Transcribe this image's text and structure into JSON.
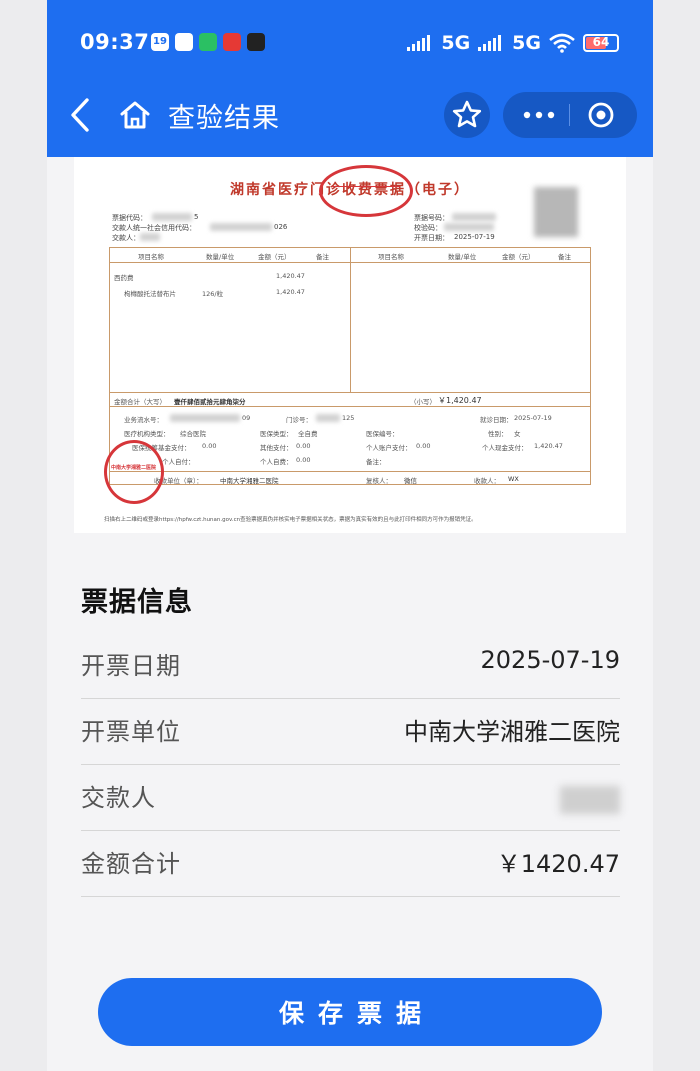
{
  "status_bar": {
    "time": "09:37",
    "network_1": "5G",
    "network_2": "5G",
    "battery": "64",
    "apps": [
      {
        "icon": "calendar-icon",
        "label": "19",
        "color": "#ffffff",
        "text_color": "#1e6ef0"
      },
      {
        "icon": "chat-bubble-icon",
        "label": "",
        "color": "#ffffff",
        "text_color": "#1e6ef0"
      },
      {
        "icon": "wechat-icon",
        "label": "",
        "color": "#2bc063",
        "text_color": "#ffffff"
      },
      {
        "icon": "red-app-icon",
        "label": "",
        "color": "#e53935",
        "text_color": "#ffffff"
      },
      {
        "icon": "black-app-icon",
        "label": "",
        "color": "#222222",
        "text_color": "#ffffff"
      }
    ]
  },
  "header": {
    "title": "查验结果",
    "back_icon": "chevron-left-icon",
    "home_icon": "home-icon",
    "favorite_icon": "star-icon",
    "more_icon": "more-dots-icon",
    "close_icon": "target-circle-icon"
  },
  "receipt": {
    "title": "湖南省医疗门诊收费票据（电子）",
    "codes_left": [
      "票据代码：",
      "交款人统一社会信用代码：",
      "交款人："
    ],
    "code_value_suffix": "5",
    "credit_value_suffix": "026",
    "codes_right": [
      "票据号码：",
      "校验码：",
      "开票日期："
    ],
    "issue_date": "2025-07-19",
    "table_headers": [
      "项目名称",
      "数量/单位",
      "金额（元）",
      "备注",
      "项目名称",
      "数量/单位",
      "金额（元）",
      "备注"
    ],
    "items": [
      {
        "name": "西药费",
        "qty": "",
        "amount": "1,420.47"
      },
      {
        "name": "枸橼酸托法替布片",
        "qty": "126/粒",
        "amount": "1,420.47"
      }
    ],
    "total_label_upper": "金额合计（大写）",
    "total_upper": "壹仟肆佰贰拾元肆角柒分",
    "total_label_lower": "（小写）",
    "total_lower": "￥1,420.47",
    "details": [
      {
        "label": "业务流水号：",
        "value": "09"
      },
      {
        "label": "门诊号：",
        "value": "125"
      },
      {
        "label": "就诊日期：",
        "value": "2025-07-19"
      },
      {
        "label": "医疗机构类型：",
        "value": "综合医院"
      },
      {
        "label": "医保类型：",
        "value": "全自费"
      },
      {
        "label": "医保编号：",
        "value": ""
      },
      {
        "label": "性别：",
        "value": "女"
      },
      {
        "label": "医保统筹基金支付：",
        "value": "0.00"
      },
      {
        "label": "其他支付：",
        "value": "0.00"
      },
      {
        "label": "个人账户支付：",
        "value": "0.00"
      },
      {
        "label": "个人现金支付：",
        "value": "1,420.47"
      },
      {
        "label": "个人自付：",
        "value": "0.00"
      },
      {
        "label": "个人自费：",
        "value": "0.00"
      },
      {
        "label": "备注：",
        "value": ""
      }
    ],
    "payee_unit_label": "收款单位（章）：",
    "payee_unit": "中南大学湘雅二医院",
    "reviewer_label": "复核人：",
    "reviewer": "微信",
    "cashier_label": "收款人：",
    "cashier": "WX",
    "footer": "扫描右上二维码或登录https://hpfw.czt.hunan.gov.cn查验票据真伪并核实电子票据相关状态，票据为真实有效的且与此打印件相同方可作为报销凭证。",
    "stamp_text": "中南大学湘雅二医院"
  },
  "info": {
    "title": "票据信息",
    "rows": [
      {
        "label": "开票日期",
        "value": "2025-07-19"
      },
      {
        "label": "开票单位",
        "value": "中南大学湘雅二医院"
      },
      {
        "label": "交款人",
        "value": ""
      },
      {
        "label": "金额合计",
        "value": "￥1420.47"
      }
    ]
  },
  "actions": {
    "save_label": "保存票据"
  }
}
